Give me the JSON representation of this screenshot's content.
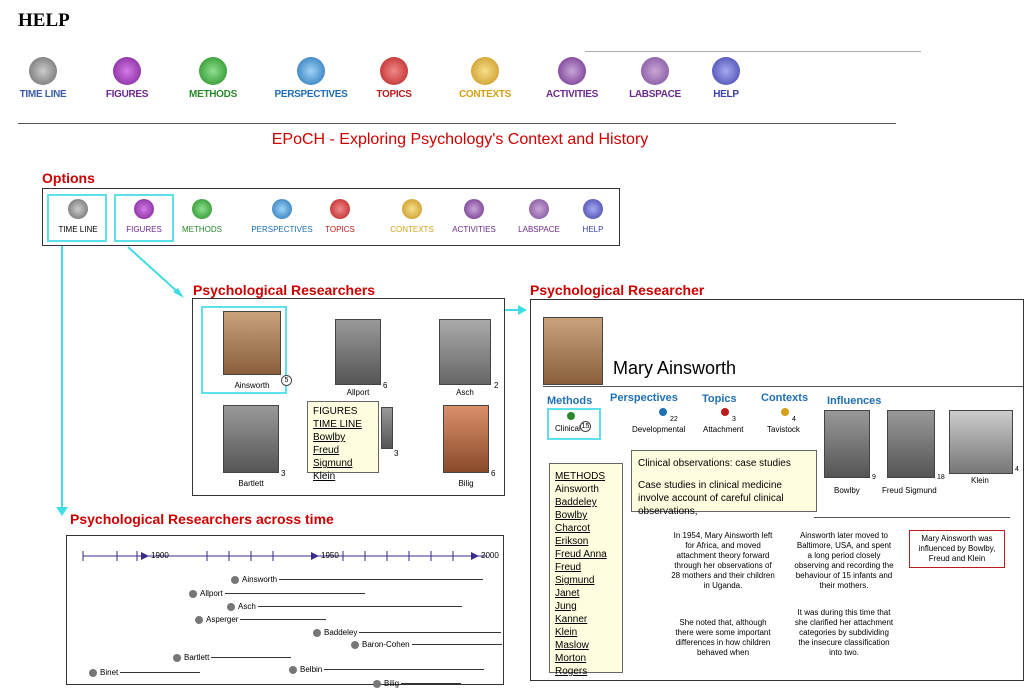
{
  "header": {
    "title": "HELP",
    "subtitle": "EPoCH - Exploring Psychology's Context and History"
  },
  "nav": [
    {
      "label": "TIME LINE",
      "color": "#3b5da8",
      "icon": "timeline-icon"
    },
    {
      "label": "FIGURES",
      "color": "#6b2a8c",
      "icon": "figures-icon"
    },
    {
      "label": "METHODS",
      "color": "#2a8a2a",
      "icon": "methods-icon"
    },
    {
      "label": "PERSPECTIVES",
      "color": "#1f6fb5",
      "icon": "perspectives-icon"
    },
    {
      "label": "TOPICS",
      "color": "#b81d1d",
      "icon": "topics-icon"
    },
    {
      "label": "CONTEXTS",
      "color": "#d4a017",
      "icon": "contexts-icon"
    },
    {
      "label": "ACTIVITIES",
      "color": "#6b2a8c",
      "icon": "activities-icon"
    },
    {
      "label": "LABSPACE",
      "color": "#6b2a8c",
      "icon": "labspace-icon"
    },
    {
      "label": "HELP",
      "color": "#3b3fa8",
      "icon": "help-icon"
    }
  ],
  "options": {
    "heading": "Options"
  },
  "researchers": {
    "heading": "Psychological Researchers",
    "people": [
      {
        "name": "Ainsworth",
        "count": "5"
      },
      {
        "name": "Allport",
        "count": "6"
      },
      {
        "name": "Asch",
        "count": "2"
      },
      {
        "name": "Bartlett",
        "count": "3"
      },
      {
        "name": "",
        "count": "3"
      },
      {
        "name": "Bilig",
        "count": "6"
      }
    ],
    "tooltip": [
      "FIGURES",
      "TIME LINE",
      "Bowlby",
      "Freud Sigmund",
      "Klein"
    ]
  },
  "researcher": {
    "heading": "Psychological Researcher",
    "name": "Mary Ainsworth",
    "tabs": {
      "methods": "Methods",
      "perspectives": "Perspectives",
      "topics": "Topics",
      "contexts": "Contexts",
      "influences": "Influences"
    },
    "method": {
      "label": "Clinical",
      "count": "15"
    },
    "perspective": {
      "label": "Developmental",
      "count": "22"
    },
    "topic": {
      "label": "Attachment",
      "count": "3"
    },
    "context": {
      "label": "Tavistock",
      "count": "4"
    },
    "influences": [
      {
        "name": "Bowlby",
        "count": "9"
      },
      {
        "name": "Freud Sigmund",
        "count": "18"
      },
      {
        "name": "Klein",
        "count": "4"
      }
    ],
    "clinical_tip": {
      "title": "Clinical observations: case studies",
      "body": "Case studies in clinical medicine involve account of careful clinical observations,"
    },
    "methods_list": [
      "METHODS",
      "Ainsworth",
      "Baddeley",
      "Bowlby",
      "Charcot",
      "Erikson",
      "Freud Anna",
      "Freud Sigmund",
      "Janet",
      "Jung",
      "Kanner",
      "Klein",
      "Maslow",
      "Morton",
      "Rogers"
    ],
    "bio1": "In 1954, Mary Ainsworth left for Africa, and moved attachment theory forward through her observations of 28 mothers and their children in Uganda.",
    "bio2": "She noted that, although there were some important differences in how children behaved when",
    "bio3": "Ainsworth later moved to Baltimore, USA, and spent a long period closely observing and recording the behaviour of 15 infants and their mothers.",
    "bio4": "It was during this time that she clarified her attachment categories by subdividing the insecure classification into two.",
    "influence_note": "Mary Ainsworth was influenced by Bowlby, Freud and Klein"
  },
  "timeline": {
    "heading": "Psychological Researchers across time",
    "ticks": [
      "1900",
      "1950",
      "2000"
    ],
    "rows": [
      "Ainsworth",
      "Allport",
      "Asch",
      "Asperger",
      "Baddeley",
      "Baron-Cohen",
      "Bartlett",
      "Belbin",
      "Binet",
      "Bilig"
    ]
  }
}
